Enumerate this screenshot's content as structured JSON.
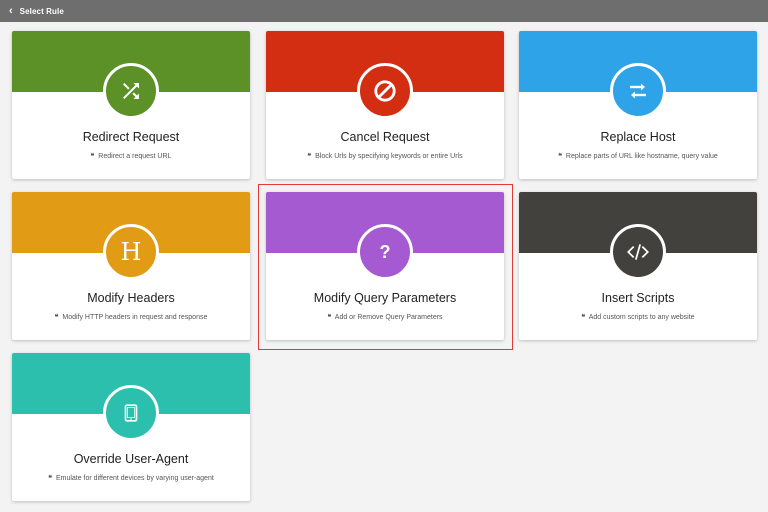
{
  "topbar": {
    "back_icon": "‹",
    "title": "Select Rule"
  },
  "quote_glyph": "❝",
  "cards": [
    {
      "title": "Redirect Request",
      "description": "Redirect a request URL",
      "color": "#5b9126",
      "icon": "shuffle-icon"
    },
    {
      "title": "Cancel Request",
      "description": "Block Urls by specifying keywords or entire Urls",
      "color": "#d42e12",
      "icon": "block-icon"
    },
    {
      "title": "Replace Host",
      "description": "Replace parts of URL like hostname, query value",
      "color": "#2ea3e8",
      "icon": "swap-arrows-icon"
    },
    {
      "title": "Modify Headers",
      "description": "Modify HTTP headers in request and response",
      "color": "#e29b14",
      "icon": "header-h-icon",
      "icon_text": "H"
    },
    {
      "title": "Modify Query Parameters",
      "description": "Add or Remove Query Parameters",
      "color": "#a55ad1",
      "icon": "question-mark-icon",
      "icon_text": "?",
      "selected": true
    },
    {
      "title": "Insert Scripts",
      "description": "Add custom scripts to any website",
      "color": "#42413e",
      "icon": "code-icon"
    },
    {
      "title": "Override User-Agent",
      "description": "Emulate for different devices by varying user-agent",
      "color": "#2cbfae",
      "icon": "tablet-icon"
    }
  ]
}
